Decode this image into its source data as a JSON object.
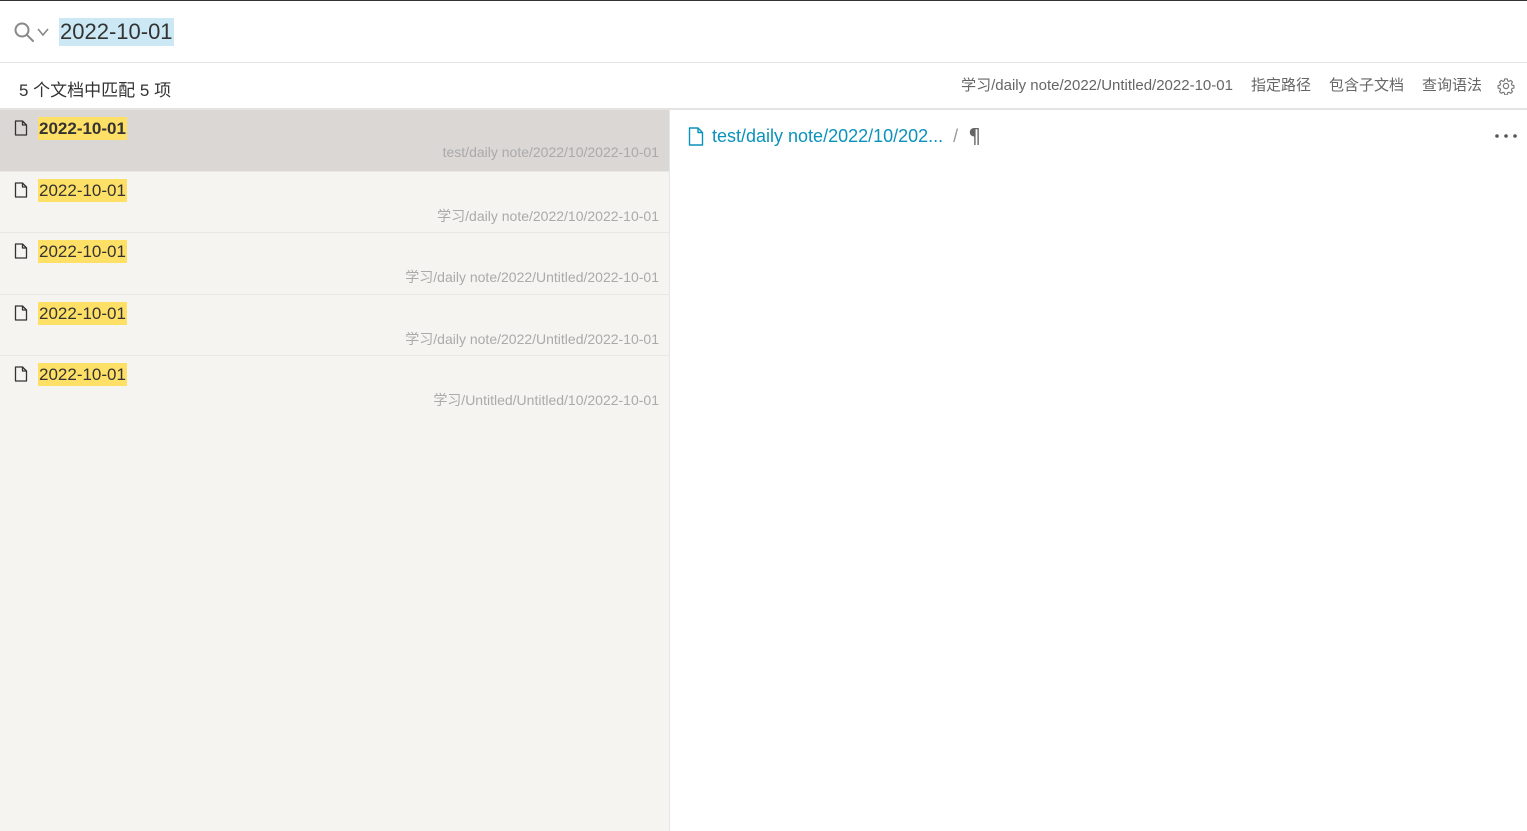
{
  "search": {
    "query": "2022-10-01"
  },
  "toolbar": {
    "summary": "5 个文档中匹配 5 项",
    "current_path": "学习/daily note/2022/Untitled/2022-10-01",
    "specify_path": "指定路径",
    "include_children": "包含子文档",
    "query_syntax": "查询语法"
  },
  "results": [
    {
      "title": "2022-10-01",
      "path": "test/daily note/2022/10/2022-10-01",
      "selected": true
    },
    {
      "title": "2022-10-01",
      "path": "学习/daily note/2022/10/2022-10-01",
      "selected": false
    },
    {
      "title": "2022-10-01",
      "path": "学习/daily note/2022/Untitled/2022-10-01",
      "selected": false
    },
    {
      "title": "2022-10-01",
      "path": "学习/daily note/2022/Untitled/2022-10-01",
      "selected": false
    },
    {
      "title": "2022-10-01",
      "path": "学习/Untitled/Untitled/10/2022-10-01",
      "selected": false
    }
  ],
  "preview": {
    "breadcrumb_path": "test/daily note/2022/10/202...",
    "separator": "/",
    "pilcrow": "¶"
  },
  "colors": {
    "highlight": "#ffe066",
    "selection": "#cce8f4",
    "link": "#0b92bb",
    "list_bg": "#f5f4f0",
    "selected_row": "#dad7d5"
  }
}
